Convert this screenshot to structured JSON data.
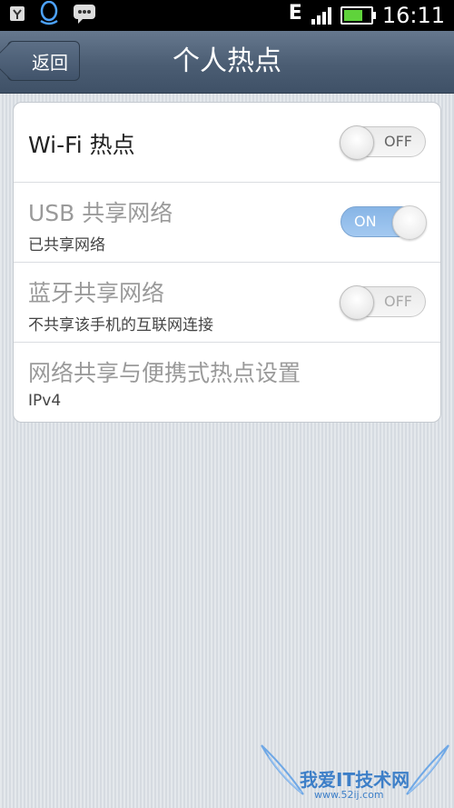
{
  "status_bar": {
    "icons": [
      "usb-debug-icon",
      "qq-icon",
      "message-icon"
    ],
    "network": "E",
    "battery_level": 0.85,
    "time": "16:11"
  },
  "title_bar": {
    "back_label": "返回",
    "title": "个人热点"
  },
  "settings": [
    {
      "title": "Wi-Fi 热点",
      "subtitle": "",
      "toggle": "OFF",
      "enabled": true
    },
    {
      "title": "USB 共享网络",
      "subtitle": "已共享网络",
      "toggle": "ON",
      "enabled": false
    },
    {
      "title": "蓝牙共享网络",
      "subtitle": "不共享该手机的互联网连接",
      "toggle": "OFF",
      "enabled": false
    },
    {
      "title": "网络共享与便携式热点设置",
      "subtitle": "IPv4",
      "toggle": "",
      "enabled": false
    }
  ],
  "watermark": {
    "text": "我爱IT技术网",
    "sub": "www.52ij.com"
  },
  "colors": {
    "titlebar": "#4b5d73",
    "toggle_on": "#6aa3e0",
    "battery": "#5fd33b",
    "watermark": "#3d7fc8"
  }
}
